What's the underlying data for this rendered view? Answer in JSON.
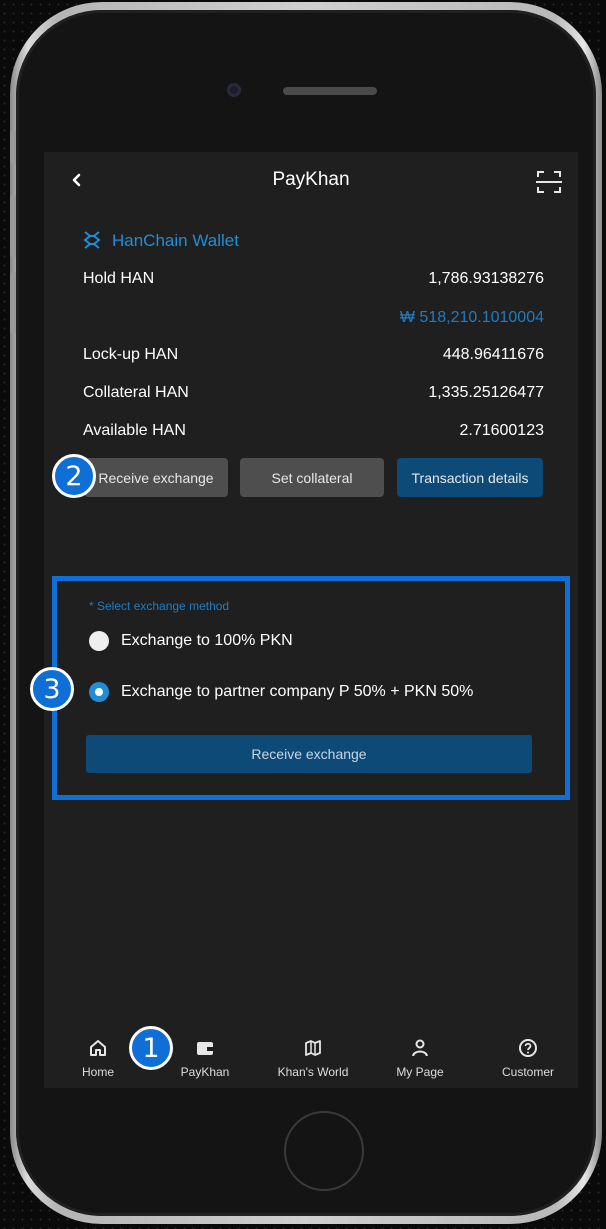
{
  "header": {
    "title": "PayKhan",
    "back_icon": "chevron-left-icon",
    "scan_icon": "qr-scan-icon"
  },
  "wallet": {
    "name": "HanChain Wallet",
    "logo_icon": "hanchain-logo-icon",
    "hold_label": "Hold HAN",
    "hold_value": "1,786.93138276",
    "hold_krw": "₩ 518,210.1010004",
    "lockup_label": "Lock-up HAN",
    "lockup_value": "448.96411676",
    "collateral_label": "Collateral HAN",
    "collateral_value": "1,335.25126477",
    "available_label": "Available HAN",
    "available_value": "2.71600123"
  },
  "actions": {
    "receive_exchange": "Receive exchange",
    "set_collateral": "Set collateral",
    "transaction_details": "Transaction details"
  },
  "exchange_method": {
    "hint": "* Select exchange method",
    "options": [
      {
        "label": "Exchange to 100% PKN",
        "selected": false
      },
      {
        "label": "Exchange to partner company P 50% + PKN 50%",
        "selected": true
      }
    ],
    "submit_label": "Receive exchange"
  },
  "tabbar": {
    "items": [
      {
        "label": "Home",
        "icon": "home-icon"
      },
      {
        "label": "PayKhan",
        "icon": "wallet-icon"
      },
      {
        "label": "Khan's World",
        "icon": "map-icon"
      },
      {
        "label": "My Page",
        "icon": "person-icon"
      },
      {
        "label": "Customer",
        "icon": "help-icon"
      }
    ]
  },
  "markers": [
    "1",
    "2",
    "3"
  ],
  "colors": {
    "accent": "#1f8ed6",
    "highlight_border": "#0f6fd6",
    "primary_button": "#0d4a78",
    "screen_bg": "#1f1f1f"
  }
}
